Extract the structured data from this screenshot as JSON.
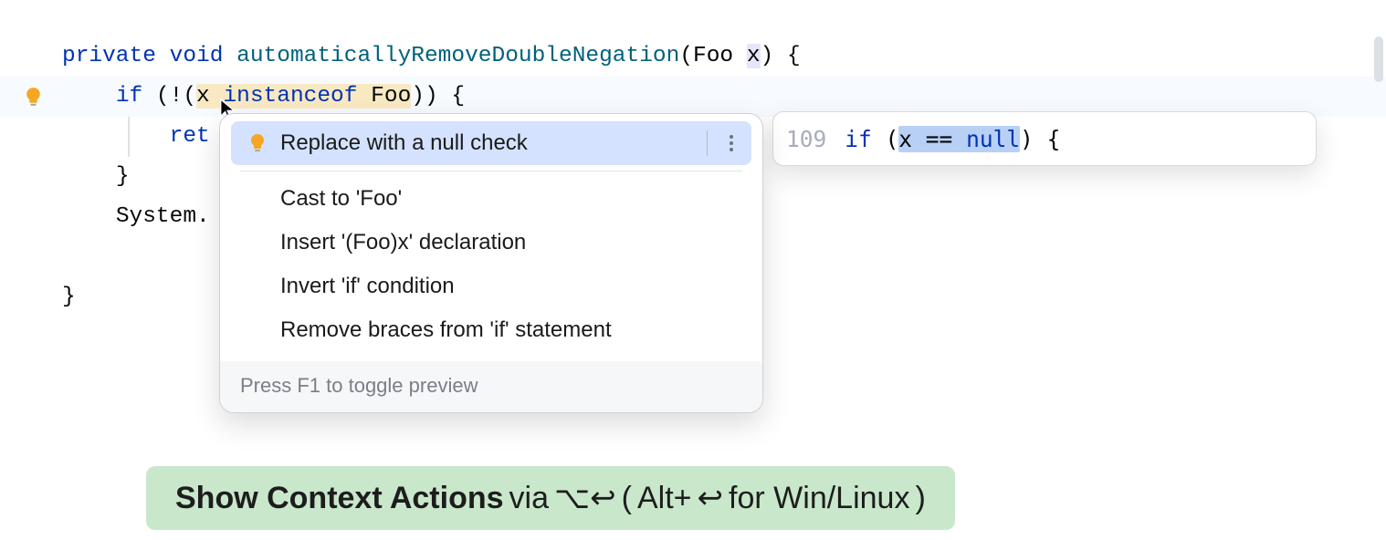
{
  "code": {
    "line1": {
      "kw_private": "private",
      "kw_void": "void",
      "method": "automaticallyRemoveDoubleNegation",
      "sig_open": "(",
      "type": "Foo",
      "space": " ",
      "param": "x",
      "sig_close_brace": ") {"
    },
    "line2": {
      "indent": "    ",
      "kw_if": "if",
      "before_warn": " (!(",
      "warn_part": "x instanceof Foo",
      "warn_x": "x ",
      "warn_inst": "instanceof",
      "warn_foo": " Foo",
      "after_warn": ")) {"
    },
    "line3": {
      "indent": "        ",
      "kw_return_frag": "ret"
    },
    "line4": {
      "indent": "    ",
      "brace": "}"
    },
    "line5": {
      "indent": "    ",
      "text": "System."
    },
    "line7": {
      "brace": "}"
    }
  },
  "popup": {
    "items": [
      {
        "label": "Replace with a null check",
        "hasBulb": true,
        "selected": true,
        "hasMenu": true
      },
      {
        "label": "Cast to 'Foo'"
      },
      {
        "label": "Insert '(Foo)x' declaration"
      },
      {
        "label": "Invert 'if' condition"
      },
      {
        "label": "Remove braces from 'if' statement"
      }
    ],
    "footer": "Press F1 to toggle preview"
  },
  "preview": {
    "lineNumber": "109",
    "kw_if": "if",
    "open": " (",
    "sel_expr": "x == ",
    "sel_null": "null",
    "close": ") {"
  },
  "hint": {
    "bold": "Show Context Actions",
    "via": " via ",
    "mac_shortcut": "⌥↩",
    "paren_open": " (",
    "alt": "Alt+",
    "enter_glyph": "↩",
    "win": " for Win/Linux",
    "paren_close": ")"
  }
}
